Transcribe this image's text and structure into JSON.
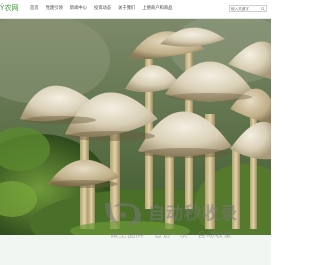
{
  "header": {
    "logo_text": "Ÿ农网",
    "nav": [
      "首页",
      "党建引领",
      "新闻中心",
      "投资动态",
      "关于我们",
      "上德商户和商品"
    ],
    "search_placeholder": "输入关键字"
  },
  "banner": {
    "image_subject": "mushrooms"
  },
  "watermark": {
    "title": "自动秒收录",
    "subtitle": "做上品牌 · 省访一次 · 自动收录"
  },
  "colors": {
    "logo_green": "#3f9b3b",
    "moss_green": "#4f7a32",
    "footer_bg": "#f2f6f3"
  }
}
